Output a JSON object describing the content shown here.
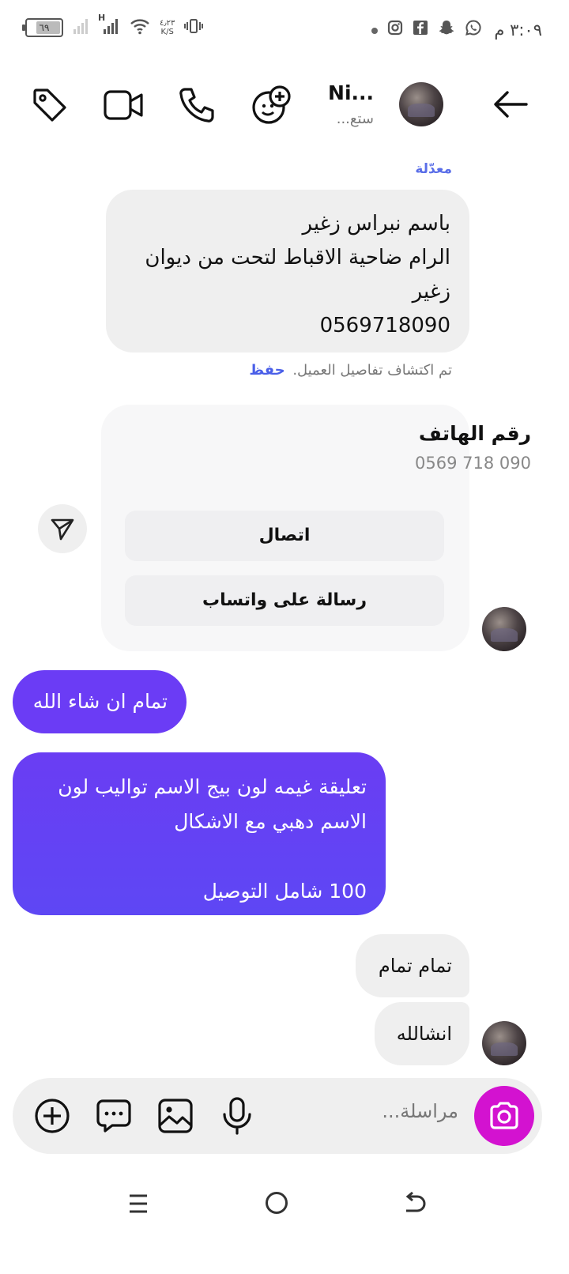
{
  "status_bar": {
    "time": "٣:٠٩ م",
    "battery": "٦٩",
    "network_type": "H",
    "net_speed_value": "٤٫٢٣",
    "net_speed_unit": "K/S",
    "icons": [
      "whatsapp-icon",
      "snapchat-icon",
      "facebook-icon",
      "instagram-icon",
      "dot-icon",
      "vibrate-icon",
      "wifi-icon",
      "signal-icon",
      "signal-icon",
      "battery-icon"
    ]
  },
  "header": {
    "name": "Ni...",
    "subtitle": "ستع...",
    "icons": [
      "back-arrow-icon",
      "avatar",
      "add-people-icon",
      "phone-icon",
      "video-icon",
      "tag-icon"
    ]
  },
  "messages": {
    "edited_label": "معدّلة",
    "msg1_lines": [
      "باسم نبراس زغير",
      "الرام ضاحية الاقباط لتحت من ديوان",
      "زغير",
      "0569718090"
    ],
    "detected_text": "تم اكتشاف تفاصيل العميل.",
    "save_label": "حفظ",
    "card_title": "رقم الهاتف",
    "card_phone": "0569 718 090",
    "call_label": "اتصال",
    "whatsapp_label": "رسالة على واتساب",
    "msg3": "تمام ان شاء الله",
    "msg4": "تعليقة غيمه لون بيج الاسم تواليب لون\nالاسم دهبي مع الاشكال\n\n100 شامل التوصيل",
    "msg5": "تمام تمام",
    "msg6": "انشالله"
  },
  "composer": {
    "placeholder": "مراسلة..."
  },
  "colors": {
    "outgoing_purple": "#6b3cf5",
    "camera_magenta": "#d312d0",
    "link_blue": "#4a5fe8",
    "incoming_grey": "#efefef"
  }
}
